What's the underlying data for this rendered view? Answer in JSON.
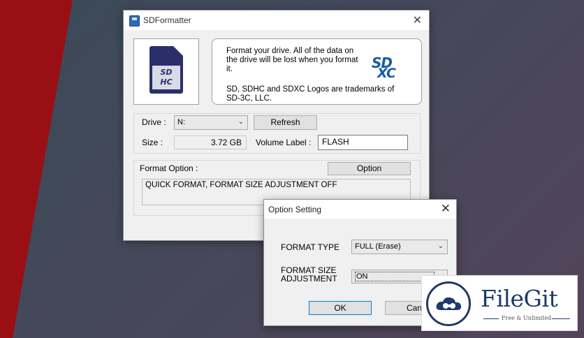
{
  "main_window": {
    "title": "SDFormatter",
    "close_symbol": "✕",
    "card_label_top": "SD",
    "card_label_bottom": "HC",
    "info_text": "Format your drive. All of the data on the drive will be lost when you format it.",
    "trademark_text": "SD, SDHC and SDXC Logos are trademarks of SD-3C, LLC.",
    "logo_line1": "SD",
    "logo_line2": "XC",
    "drive_label": "Drive :",
    "drive_value": "N:",
    "refresh_button": "Refresh",
    "size_label": "Size :",
    "size_value": "3.72 GB",
    "volume_label": "Volume Label :",
    "volume_value": "FLASH",
    "format_option_label": "Format Option :",
    "option_button": "Option",
    "format_option_value": "QUICK FORMAT, FORMAT SIZE ADJUSTMENT OFF"
  },
  "option_dialog": {
    "title": "Option Setting",
    "close_symbol": "✕",
    "format_type_label": "FORMAT TYPE",
    "format_type_value": "FULL (Erase)",
    "size_adjust_label_1": "FORMAT SIZE",
    "size_adjust_label_2": "ADJUSTMENT",
    "size_adjust_value": "ON",
    "ok_button": "OK",
    "cancel_button": "Canc"
  },
  "watermark": {
    "name": "FileGit",
    "tagline": "Free & Unlimited",
    "accent_color": "#1f3a6b"
  },
  "icons": {
    "app": "sdformatter-app-icon",
    "dropdown": "chevron-down-icon",
    "close": "close-icon",
    "watermark": "cloud-logo-icon"
  }
}
